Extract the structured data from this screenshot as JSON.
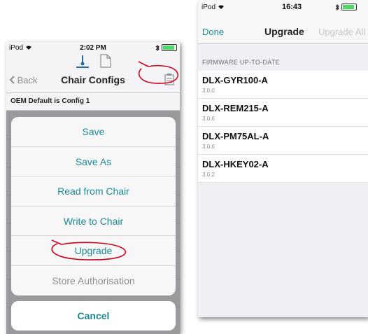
{
  "left": {
    "status": {
      "carrier": "iPod",
      "time": "2:02 PM"
    },
    "nav": {
      "back": "Back",
      "title": "Chair Configs"
    },
    "oem_text": "OEM Default is Config 1",
    "sheet_items": [
      "Save",
      "Save As",
      "Read from Chair",
      "Write to Chair",
      "Upgrade",
      "Store Authorisation"
    ],
    "cancel": "Cancel"
  },
  "right": {
    "status": {
      "carrier": "iPod",
      "time": "16:43"
    },
    "nav": {
      "done": "Done",
      "title": "Upgrade",
      "upgrade_all": "Upgrade All"
    },
    "section_header": "FIRMWARE UP-TO-DATE",
    "firmware": [
      {
        "name": "DLX-GYR100-A",
        "version": "3.0.0"
      },
      {
        "name": "DLX-REM215-A",
        "version": "3.0.6"
      },
      {
        "name": "DLX-PM75AL-A",
        "version": "3.0.6"
      },
      {
        "name": "DLX-HKEY02-A",
        "version": "3.0.2"
      }
    ]
  },
  "colors": {
    "accent": "#1a8a95",
    "annotation": "#d0021b",
    "battery": "#4cd964"
  },
  "icons": [
    "wifi-icon",
    "bluetooth-icon",
    "battery-icon",
    "chair-config-icon",
    "document-icon",
    "chevron-left-icon",
    "clipboard-icon"
  ]
}
